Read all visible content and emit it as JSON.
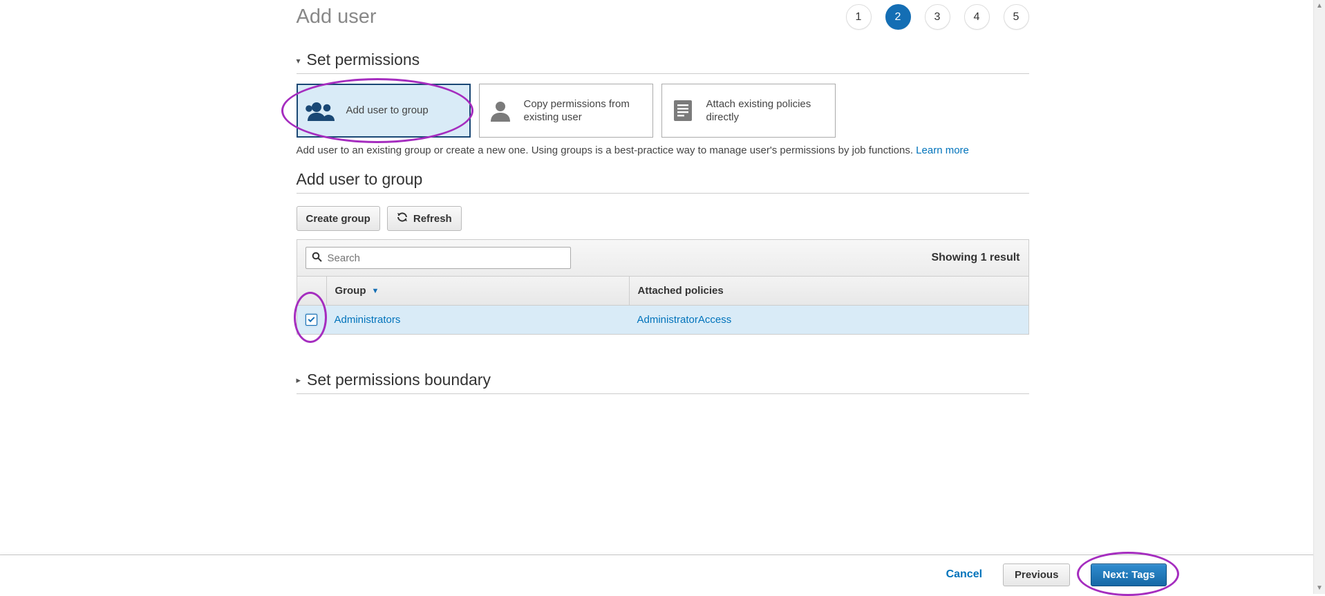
{
  "page_title": "Add user",
  "steps": {
    "items": [
      "1",
      "2",
      "3",
      "4",
      "5"
    ],
    "active_index": 1
  },
  "permissions": {
    "section_title": "Set permissions",
    "options": [
      {
        "label": "Add user to group",
        "icon": "group",
        "selected": true
      },
      {
        "label": "Copy permissions from existing user",
        "icon": "user",
        "selected": false
      },
      {
        "label": "Attach existing policies directly",
        "icon": "document",
        "selected": false
      }
    ],
    "hint_text": "Add user to an existing group or create a new one. Using groups is a best-practice way to manage user's permissions by job functions. ",
    "learn_more": "Learn more"
  },
  "group_section": {
    "title": "Add user to group",
    "create_group_btn": "Create group",
    "refresh_btn": "Refresh",
    "search_placeholder": "Search",
    "result_count": "Showing 1 result",
    "col_group": "Group",
    "col_policies": "Attached policies",
    "rows": [
      {
        "checked": true,
        "group": "Administrators",
        "policy": "AdministratorAccess"
      }
    ]
  },
  "boundary_title": "Set permissions boundary",
  "footer": {
    "cancel": "Cancel",
    "previous": "Previous",
    "next": "Next: Tags"
  },
  "annotations": {
    "option_oval": true,
    "checkbox_oval": true,
    "next_oval": true
  }
}
